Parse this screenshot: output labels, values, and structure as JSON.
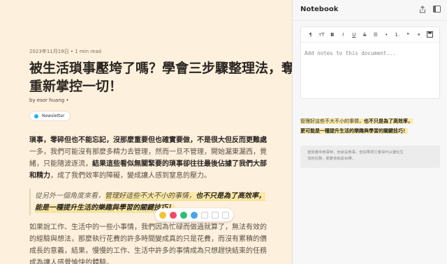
{
  "article": {
    "date_meta": "2023年11月19日 • 1 min read",
    "title_line1": "被生活瑣事壓垮了嗎？學會三步驟整理法，奪",
    "title_line2": "重新掌控一切！",
    "byline": "by esor huang •",
    "tag_label": "Newsletter",
    "para1_line1_plain": "瑣事，零碎但也不能忘記，沒那麼重要但也確實要做，不是很大但反而更難處",
    "para1_line2_plain": "一多，我們可能沒有那麼多精力去管理，然而一旦不管理，開始漏東漏西，覺",
    "para1_line3_plain": "緒，只能隨波逐流，",
    "para1_line3_bold": "結果這些看似無關緊要的瑣事卻往往最後佔據了我們大部",
    "para1_line4_bold": "和精力",
    "para1_line4_plain": "，成了我們效率的障礙，變成讓人感到窒息的壓力。",
    "quote_line1_plain": "從另外一個角度來看，",
    "quote_line1_hl": "管理好這些不大不小的事情，",
    "quote_line1_bold": "也不只是為了高效率，",
    "quote_line2_bold": "能是一種提升生活的樂趣與學習的關鍵技巧！",
    "para2_line1": "如果說工作、生活中的一些小事情，我們因為忙碌而做過就算了，無法有效的",
    "para2_line2": "的經驗與想法，那麼執行花費的許多時間變成真的只是花費，而沒有累積的價",
    "para2_line3": "成長的意義，結果，慢慢的工作、生活中許多的事情成為只想趕快結束的任務",
    "para2_line4": "成為讓人感覺愉快的體驗。"
  },
  "highlight_toolbar": {
    "colors": [
      "#f2c531",
      "#2fbf71",
      "#ef4b63",
      "#4aa3f0"
    ],
    "icons": [
      "note-icon",
      "copy-icon",
      "duplicate-icon"
    ]
  },
  "notebook": {
    "title": "Notebook",
    "header_icons": [
      "share-icon",
      "sidebar-toggle-icon"
    ],
    "format_buttons": [
      "¶",
      "ᴛT",
      "B",
      "I",
      "U",
      "S",
      "☰",
      "•",
      "1.",
      "❝",
      "⚭"
    ],
    "save_icon": "💾",
    "editor_placeholder": "Add notes to this document...",
    "highlight_text_plain": "管理好這些不大不小的事情，",
    "highlight_text_bold1": "也不只是為了高效率，",
    "highlight_text_bold2": "更可能是一種提升生活的樂趣與學習的關鍵技巧！",
    "note_card_line1": "當我看待瑣事時，他就是瑣事，但如果把它看得可以優化生",
    "note_card_line2": "活的任務，那麼他就是目標。"
  }
}
